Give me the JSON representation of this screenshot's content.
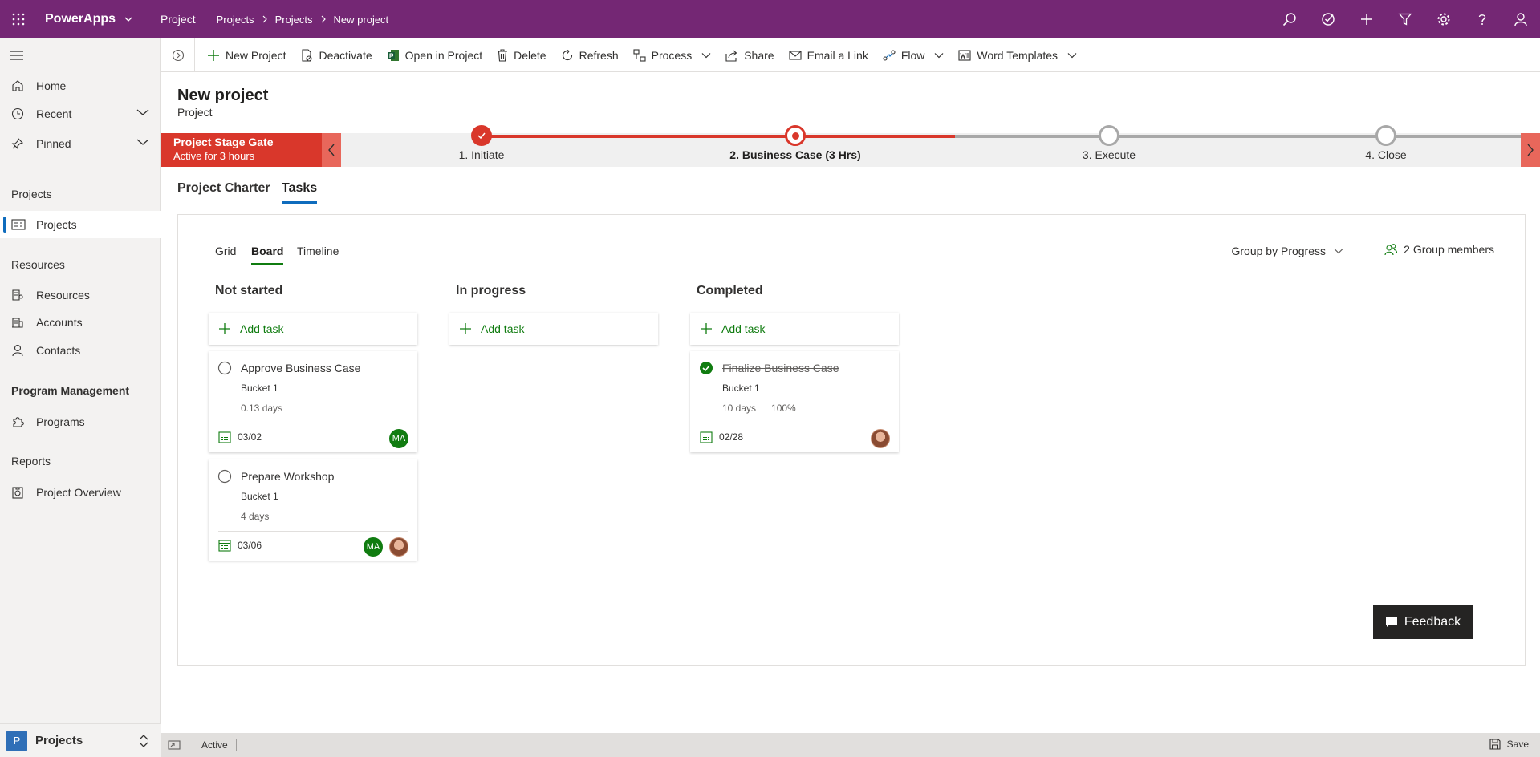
{
  "topbar": {
    "app_name": "PowerApps",
    "module": "Project",
    "breadcrumb": [
      "Projects",
      "Projects",
      "New project"
    ]
  },
  "sidebar": {
    "top_items": [
      {
        "label": "Home",
        "icon": "home-icon"
      },
      {
        "label": "Recent",
        "icon": "clock-icon"
      },
      {
        "label": "Pinned",
        "icon": "pin-icon"
      }
    ],
    "groups": [
      {
        "title": "Projects",
        "items": [
          {
            "label": "Projects",
            "icon": "project-list-icon"
          }
        ]
      },
      {
        "title": "Resources",
        "items": [
          {
            "label": "Resources",
            "icon": "resource-icon"
          },
          {
            "label": "Accounts",
            "icon": "account-icon"
          },
          {
            "label": "Contacts",
            "icon": "contact-icon"
          }
        ]
      },
      {
        "title": "Program Management",
        "items": [
          {
            "label": "Programs",
            "icon": "puzzle-icon"
          }
        ]
      },
      {
        "title": "Reports",
        "items": [
          {
            "label": "Project Overview",
            "icon": "report-icon"
          }
        ]
      }
    ],
    "area": {
      "badge": "P",
      "label": "Projects"
    }
  },
  "commands": [
    {
      "label": "New Project",
      "icon": "plus-icon"
    },
    {
      "label": "Deactivate",
      "icon": "deactivate-icon"
    },
    {
      "label": "Open in Project",
      "icon": "project-app-icon"
    },
    {
      "label": "Delete",
      "icon": "trash-icon"
    },
    {
      "label": "Refresh",
      "icon": "refresh-icon"
    },
    {
      "label": "Process",
      "icon": "process-icon",
      "has_menu": true
    },
    {
      "label": "Share",
      "icon": "share-icon"
    },
    {
      "label": "Email a Link",
      "icon": "email-icon"
    },
    {
      "label": "Flow",
      "icon": "flow-icon",
      "has_menu": true
    },
    {
      "label": "Word Templates",
      "icon": "word-icon",
      "has_menu": true
    }
  ],
  "record": {
    "title": "New project",
    "entity": "Project"
  },
  "bpf": {
    "name": "Project Stage Gate",
    "active_for": "Active for 3 hours",
    "stages": [
      {
        "label": "1. Initiate",
        "state": "completed"
      },
      {
        "label": "2. Business Case  (3 Hrs)",
        "state": "active"
      },
      {
        "label": "3. Execute",
        "state": "pending"
      },
      {
        "label": "4. Close",
        "state": "pending"
      }
    ]
  },
  "form_tabs": [
    {
      "label": "Project Charter",
      "selected": false
    },
    {
      "label": "Tasks",
      "selected": true
    }
  ],
  "board": {
    "views": [
      {
        "label": "Grid",
        "selected": false
      },
      {
        "label": "Board",
        "selected": true
      },
      {
        "label": "Timeline",
        "selected": false
      }
    ],
    "group_by": "Group by Progress",
    "members": "2 Group members",
    "add_task_label": "Add task",
    "columns": [
      {
        "title": "Not started",
        "tasks": [
          {
            "name": "Approve Business Case",
            "bucket": "Bucket 1",
            "duration": "0.13 days",
            "percent": "",
            "date": "03/02",
            "done": false,
            "assignees": [
              "MA"
            ]
          },
          {
            "name": "Prepare Workshop",
            "bucket": "Bucket 1",
            "duration": "4 days",
            "percent": "",
            "date": "03/06",
            "done": false,
            "assignees": [
              "MA",
              "photo"
            ]
          }
        ]
      },
      {
        "title": "In progress",
        "tasks": []
      },
      {
        "title": "Completed",
        "tasks": [
          {
            "name": "Finalize Business Case",
            "bucket": "Bucket 1",
            "duration": "10 days",
            "percent": "100%",
            "date": "02/28",
            "done": true,
            "assignees": [
              "photo"
            ]
          }
        ]
      }
    ]
  },
  "feedback_label": "Feedback",
  "status": {
    "text": "Active",
    "save_label": "Save"
  },
  "colors": {
    "brand": "#742774",
    "bpf_active": "#d9372b",
    "accent_green": "#107c10",
    "selected_tab": "#0f6cbd"
  }
}
